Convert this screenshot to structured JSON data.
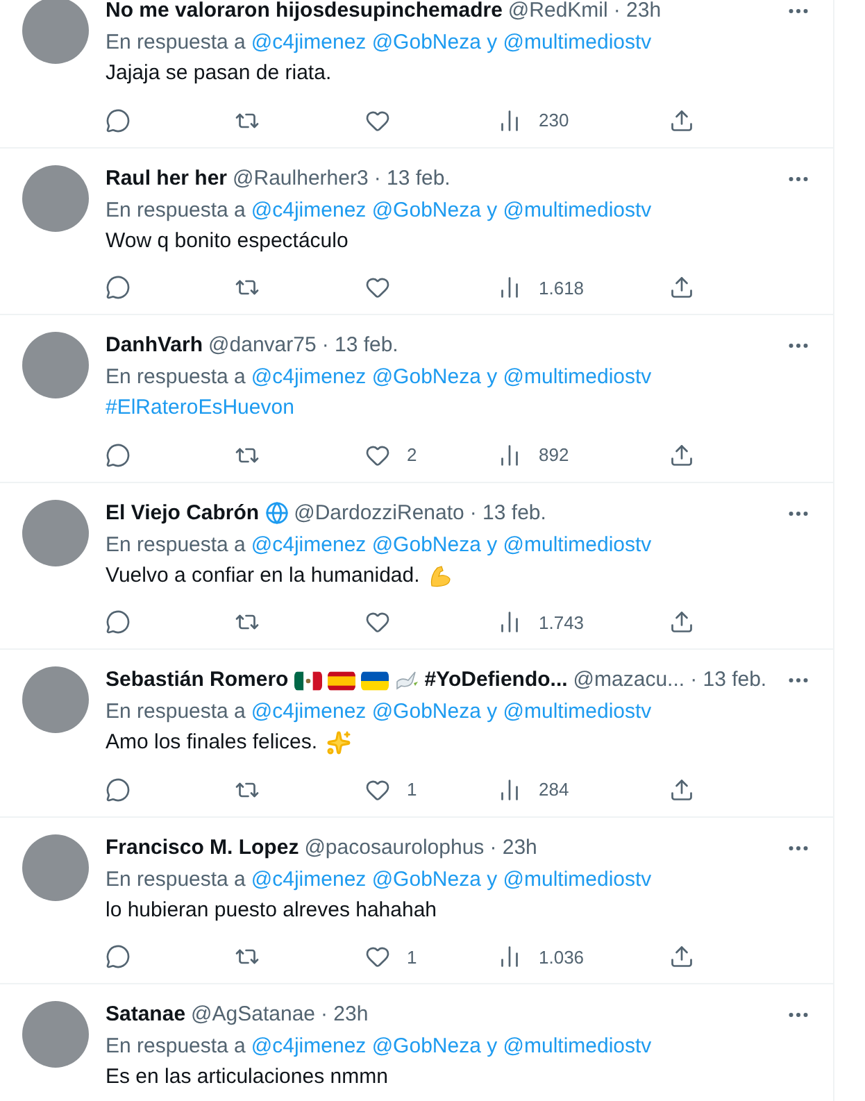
{
  "tweets": [
    {
      "name": "No me valoraron hijosdesupinchemadre",
      "handle": "@RedKmil",
      "time": "· 23h",
      "reply": [
        {
          "text": "En respuesta a",
          "kind": "plain"
        },
        {
          "text": "@c4jimenez @GobNeza y @multimediostv",
          "kind": "link"
        }
      ],
      "body": {
        "text": "Jajaja se pasan de riata.",
        "kind": "text"
      },
      "actions": [
        {
          "kind": "reply"
        },
        {
          "kind": "retweet"
        },
        {
          "kind": "like"
        },
        {
          "kind": "views",
          "count": "230"
        },
        {
          "kind": "share"
        }
      ]
    },
    {
      "name": "Raul her her",
      "handle": "@Raulherher3",
      "time": "· 13 feb.",
      "reply": [
        {
          "text": "En respuesta a",
          "kind": "plain"
        },
        {
          "text": "@c4jimenez @GobNeza y @multimediostv",
          "kind": "link"
        }
      ],
      "body": {
        "text": "Wow q bonito espectáculo",
        "kind": "text"
      },
      "actions": [
        {
          "kind": "reply"
        },
        {
          "kind": "retweet"
        },
        {
          "kind": "like"
        },
        {
          "kind": "views",
          "count": "1.618"
        },
        {
          "kind": "share"
        }
      ]
    },
    {
      "name": "DanhVarh",
      "handle": "@danvar75",
      "time": "· 13 feb.",
      "reply": [
        {
          "text": "En respuesta a",
          "kind": "plain"
        },
        {
          "text": "@c4jimenez @GobNeza y @multimediostv",
          "kind": "link"
        }
      ],
      "body": {
        "text": "#ElRateroEsHuevon",
        "kind": "hashtag"
      },
      "actions": [
        {
          "kind": "reply"
        },
        {
          "kind": "retweet"
        },
        {
          "kind": "like",
          "count": "2"
        },
        {
          "kind": "views",
          "count": "892"
        },
        {
          "kind": "share"
        }
      ]
    },
    {
      "name": "El Viejo Cabrón",
      "badges": [
        {
          "kind": "globe"
        }
      ],
      "handle": "@DardozziRenato",
      "time": "· 13 feb.",
      "reply": [
        {
          "text": "En respuesta a",
          "kind": "plain"
        },
        {
          "text": "@c4jimenez @GobNeza y @multimediostv",
          "kind": "link"
        }
      ],
      "body": {
        "text": "Vuelvo a confiar en la humanidad.",
        "kind": "text",
        "emoji": {
          "kind": "flex"
        }
      },
      "actions": [
        {
          "kind": "reply"
        },
        {
          "kind": "retweet"
        },
        {
          "kind": "like"
        },
        {
          "kind": "views",
          "count": "1.743"
        },
        {
          "kind": "share"
        }
      ]
    },
    {
      "name": "Sebastián Romero",
      "badges": [
        {
          "kind": "mx"
        },
        {
          "kind": "es"
        },
        {
          "kind": "ua"
        },
        {
          "kind": "dove"
        }
      ],
      "name_suffix": "#YoDefiendo...",
      "handle": "@mazacu...",
      "time": "· 13 feb.",
      "reply": [
        {
          "text": "En respuesta a",
          "kind": "plain"
        },
        {
          "text": "@c4jimenez @GobNeza y @multimediostv",
          "kind": "link"
        }
      ],
      "body": {
        "text": "Amo los finales felices.",
        "kind": "text",
        "emoji": {
          "kind": "sparkles"
        }
      },
      "actions": [
        {
          "kind": "reply"
        },
        {
          "kind": "retweet"
        },
        {
          "kind": "like",
          "count": "1"
        },
        {
          "kind": "views",
          "count": "284"
        },
        {
          "kind": "share"
        }
      ]
    },
    {
      "name": "Francisco M. Lopez",
      "handle": "@pacosaurolophus",
      "time": "· 23h",
      "reply": [
        {
          "text": "En respuesta a",
          "kind": "plain"
        },
        {
          "text": "@c4jimenez @GobNeza y @multimediostv",
          "kind": "link"
        }
      ],
      "body": {
        "text": "lo hubieran puesto alreves hahahah",
        "kind": "text"
      },
      "actions": [
        {
          "kind": "reply"
        },
        {
          "kind": "retweet"
        },
        {
          "kind": "like",
          "count": "1"
        },
        {
          "kind": "views",
          "count": "1.036"
        },
        {
          "kind": "share"
        }
      ]
    },
    {
      "name": "Satanae",
      "handle": "@AgSatanae",
      "time": "· 23h",
      "reply": [
        {
          "text": "En respuesta a",
          "kind": "plain"
        },
        {
          "text": "@c4jimenez @GobNeza y @multimediostv",
          "kind": "link"
        }
      ],
      "body": {
        "text": "Es en las articulaciones nmmn",
        "kind": "text"
      }
    }
  ]
}
